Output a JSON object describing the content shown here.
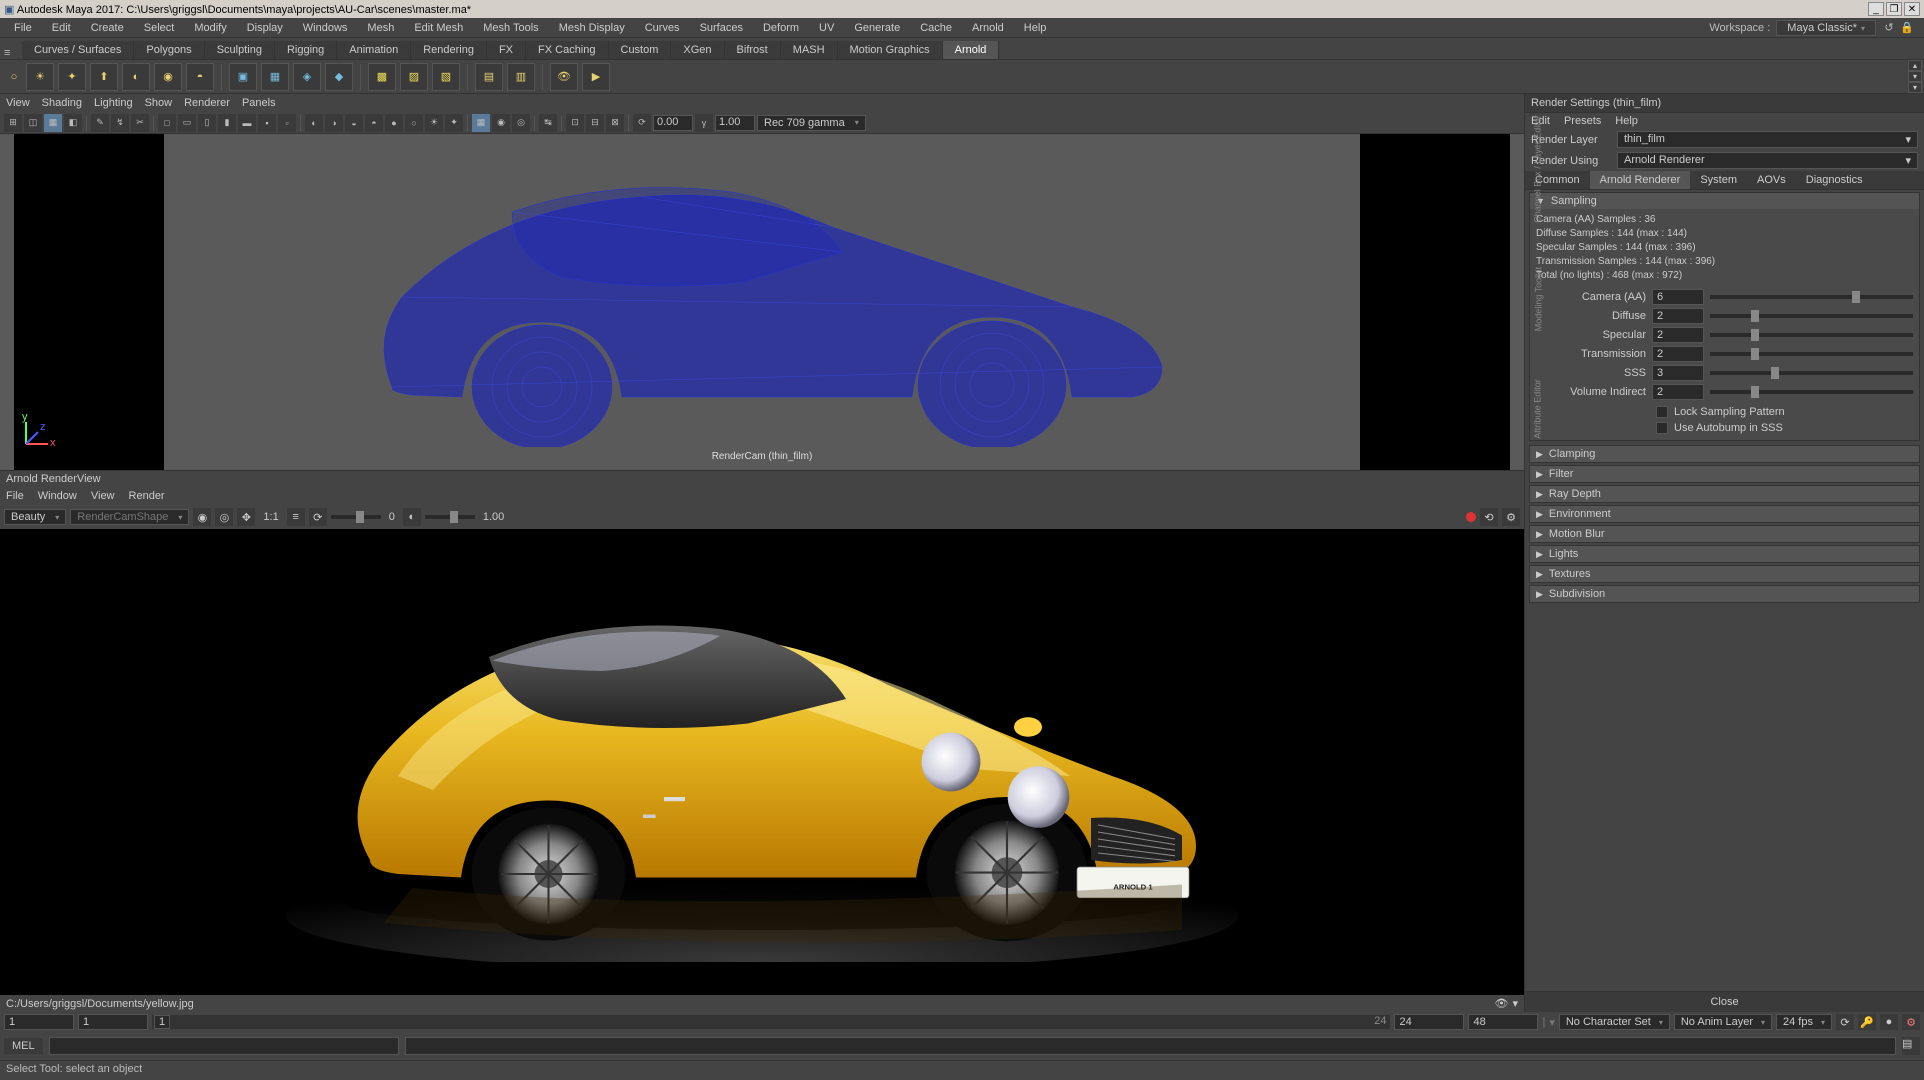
{
  "title": "Autodesk Maya 2017: C:\\Users\\griggsl\\Documents\\maya\\projects\\AU-Car\\scenes\\master.ma*",
  "menus": [
    "File",
    "Edit",
    "Create",
    "Select",
    "Modify",
    "Display",
    "Windows",
    "Mesh",
    "Edit Mesh",
    "Mesh Tools",
    "Mesh Display",
    "Curves",
    "Surfaces",
    "Deform",
    "UV",
    "Generate",
    "Cache",
    "Arnold",
    "Help"
  ],
  "workspace": {
    "label": "Workspace :",
    "value": "Maya Classic*"
  },
  "shelfTabs": [
    "Curves / Surfaces",
    "Polygons",
    "Sculpting",
    "Rigging",
    "Animation",
    "Rendering",
    "FX",
    "FX Caching",
    "Custom",
    "XGen",
    "Bifrost",
    "MASH",
    "Motion Graphics",
    "Arnold"
  ],
  "shelfActive": 13,
  "viewportMenus": [
    "View",
    "Shading",
    "Lighting",
    "Show",
    "Renderer",
    "Panels"
  ],
  "vpToolbar": {
    "val1": "0.00",
    "val2": "1.00",
    "gamma": "Rec 709 gamma"
  },
  "vpCamera": "RenderCam (thin_film)",
  "sideLabels": [
    "Channel Box / Layer Editor",
    "Modeling Toolkit",
    "Attribute Editor"
  ],
  "renderView": {
    "title": "Arnold RenderView",
    "menus": [
      "File",
      "Window",
      "View",
      "Render"
    ],
    "beauty": "Beauty",
    "shape": "RenderCamShape",
    "sliderA": "0",
    "sliderB": "1.00",
    "ratio": "1:1",
    "path": "C:/Users/griggsl/Documents/yellow.jpg",
    "plate": "ARNOLD 1"
  },
  "renderSettings": {
    "title": "Render Settings (thin_film)",
    "menus": [
      "Edit",
      "Presets",
      "Help"
    ],
    "layerLabel": "Render Layer",
    "layerValue": "thin_film",
    "usingLabel": "Render Using",
    "usingValue": "Arnold Renderer",
    "tabs": [
      "Common",
      "Arnold Renderer",
      "System",
      "AOVs",
      "Diagnostics"
    ],
    "activeTab": 1,
    "sampling": {
      "title": "Sampling",
      "stats": [
        "Camera (AA) Samples : 36",
        "Diffuse Samples : 144 (max : 144)",
        "Specular Samples : 144 (max : 396)",
        "Transmission Samples : 144 (max : 396)",
        "Total (no lights) : 468 (max : 972)"
      ],
      "params": [
        {
          "label": "Camera (AA)",
          "value": "6",
          "pos": 70
        },
        {
          "label": "Diffuse",
          "value": "2",
          "pos": 20
        },
        {
          "label": "Specular",
          "value": "2",
          "pos": 20
        },
        {
          "label": "Transmission",
          "value": "2",
          "pos": 20
        },
        {
          "label": "SSS",
          "value": "3",
          "pos": 30
        },
        {
          "label": "Volume Indirect",
          "value": "2",
          "pos": 20
        }
      ],
      "checks": [
        "Lock Sampling Pattern",
        "Use Autobump in SSS"
      ]
    },
    "collapsed": [
      "Clamping",
      "Filter",
      "Ray Depth",
      "Environment",
      "Motion Blur",
      "Lights",
      "Textures",
      "Subdivision"
    ],
    "close": "Close"
  },
  "timeline": {
    "start1": "1",
    "start2": "1",
    "current": "1",
    "currentEnd": "24",
    "end1": "24",
    "end2": "48",
    "charset": "No Character Set",
    "animlayer": "No Anim Layer",
    "fps": "24 fps"
  },
  "cmd": {
    "lang": "MEL"
  },
  "status": "Select Tool: select an object"
}
